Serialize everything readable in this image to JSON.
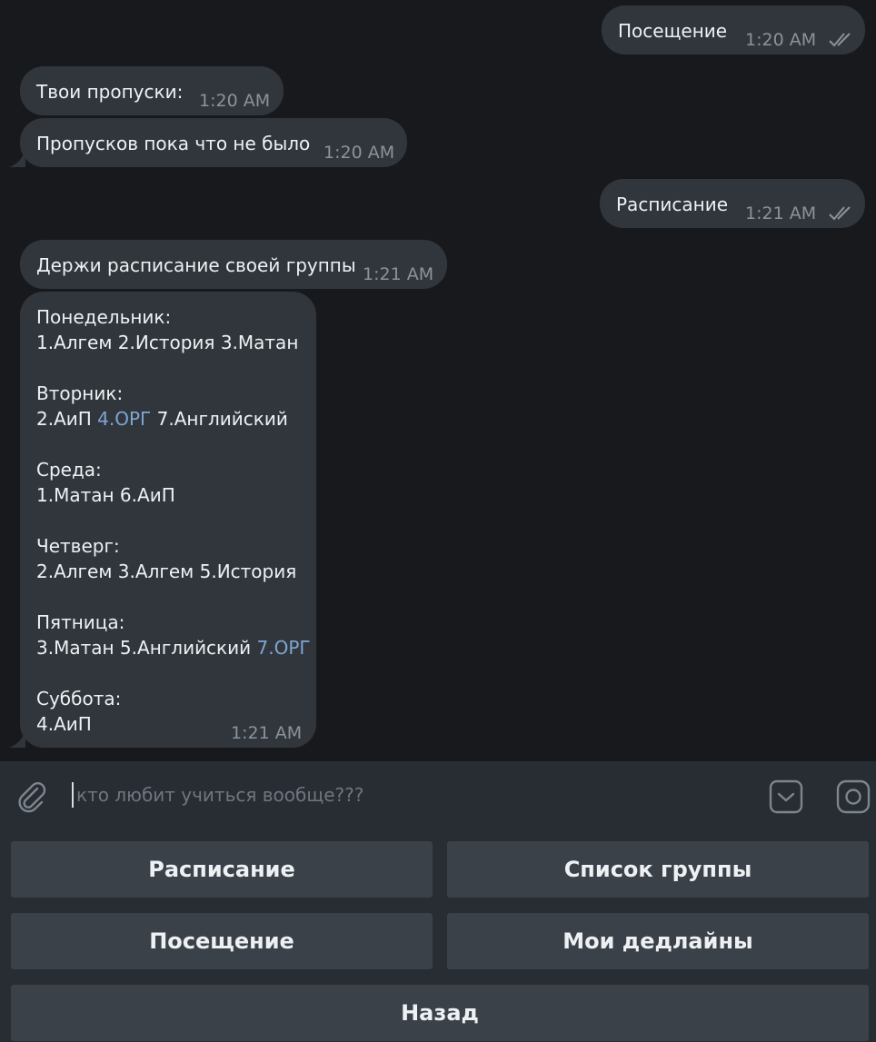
{
  "messages": {
    "m1": {
      "text": "Посещение",
      "time": "1:20 AM"
    },
    "m2": {
      "text": "Твои пропуски:",
      "time": "1:20 AM"
    },
    "m3": {
      "text": "Пропусков пока что не было",
      "time": "1:20 AM"
    },
    "m4": {
      "text": "Расписание",
      "time": "1:21 AM"
    },
    "m5": {
      "text": "Держи расписание своей группы",
      "time": "1:21 AM"
    },
    "m6": {
      "time": "1:21 AM",
      "monday": {
        "day": "Понедельник:",
        "lessons": "1.Алгем 2.История 3.Матан"
      },
      "tuesday": {
        "day": "Вторник:",
        "pre": "2.АиП ",
        "link": "4.ОРГ",
        "post": " 7.Английский"
      },
      "wednesday": {
        "day": "Среда:",
        "lessons": "1.Матан 6.АиП"
      },
      "thursday": {
        "day": "Четверг:",
        "lessons": "2.Алгем 3.Алгем 5.История"
      },
      "friday": {
        "day": "Пятница:",
        "pre": "3.Матан 5.Английский ",
        "link": "7.ОРГ"
      },
      "saturday": {
        "day": "Суббота:",
        "lessons": "4.АиП"
      }
    }
  },
  "composer": {
    "placeholder": "кто любит учиться вообще???"
  },
  "keyboard": {
    "schedule": "Расписание",
    "group_list": "Список группы",
    "attendance": "Посещение",
    "deadlines": "Мои дедлайны",
    "back": "Назад"
  },
  "colors": {
    "bubble": "#31363c",
    "background": "#17191d",
    "link": "#7fa5d1",
    "keyboard_button": "#3b4148"
  }
}
